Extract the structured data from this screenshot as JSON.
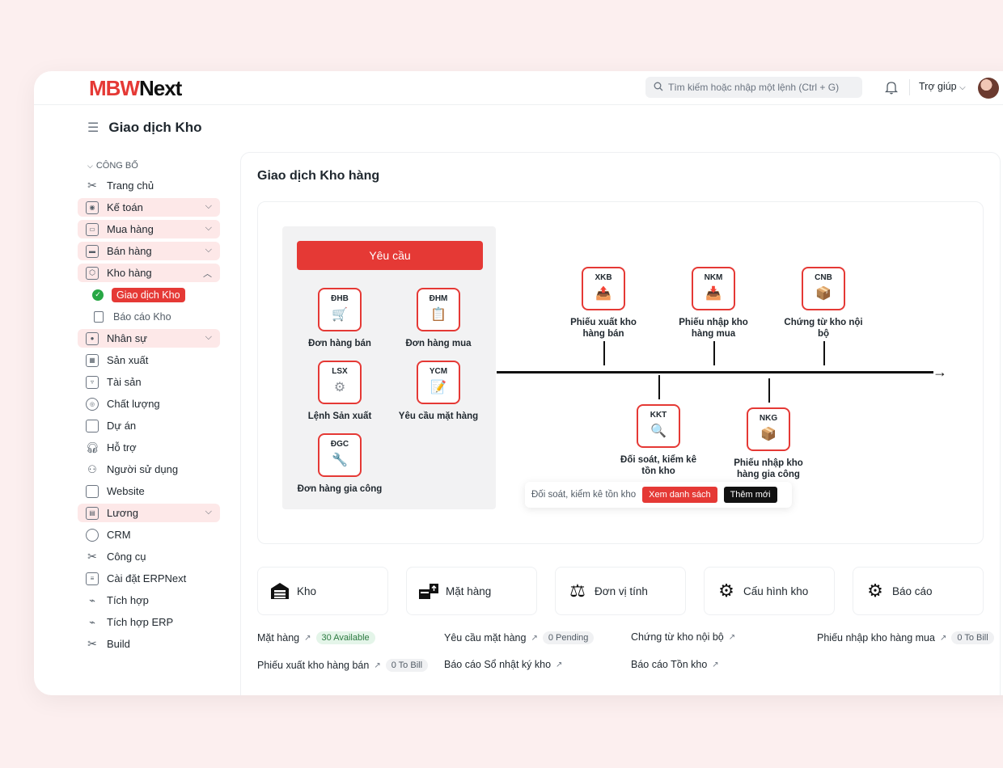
{
  "header": {
    "logo_brand": "MBW",
    "logo_next": "Next",
    "search_placeholder": "Tìm kiếm hoặc nhập một lệnh (Ctrl + G)",
    "help_label": "Trợ giúp"
  },
  "page": {
    "title": "Giao dịch Kho"
  },
  "sidebar": {
    "section": "CÔNG BỐ",
    "items": [
      {
        "label": "Trang chủ"
      },
      {
        "label": "Kế toán"
      },
      {
        "label": "Mua hàng"
      },
      {
        "label": "Bán hàng"
      },
      {
        "label": "Kho hàng"
      },
      {
        "label": "Nhân sự"
      },
      {
        "label": "Sản xuất"
      },
      {
        "label": "Tài sản"
      },
      {
        "label": "Chất lượng"
      },
      {
        "label": "Dự án"
      },
      {
        "label": "Hỗ trợ"
      },
      {
        "label": "Người sử dụng"
      },
      {
        "label": "Website"
      },
      {
        "label": "Lương"
      },
      {
        "label": "CRM"
      },
      {
        "label": "Công cụ"
      },
      {
        "label": "Cài đặt ERPNext"
      },
      {
        "label": "Tích hợp"
      },
      {
        "label": "Tích hợp ERP"
      },
      {
        "label": "Build"
      }
    ],
    "sub_active": "Giao dịch Kho",
    "sub_other": "Báo cáo Kho"
  },
  "main": {
    "title": "Giao dịch Kho hàng",
    "request_button": "Yêu cầu",
    "request_nodes": [
      {
        "code": "ĐHB",
        "label": "Đơn hàng bán"
      },
      {
        "code": "ĐHM",
        "label": "Đơn hàng mua"
      },
      {
        "code": "LSX",
        "label": "Lệnh Sản xuất"
      },
      {
        "code": "YCM",
        "label": "Yêu cầu mặt hàng"
      },
      {
        "code": "ĐGC",
        "label": "Đơn hàng gia công"
      }
    ],
    "flow_nodes": [
      {
        "code": "XKB",
        "label": "Phiếu xuất kho hàng bán"
      },
      {
        "code": "NKM",
        "label": "Phiếu nhập kho hàng mua"
      },
      {
        "code": "CNB",
        "label": "Chứng từ kho nội bộ"
      },
      {
        "code": "KKT",
        "label": "Đối soát, kiểm kê tồn kho"
      },
      {
        "code": "NKG",
        "label": "Phiếu nhập kho hàng gia công"
      }
    ],
    "tooltip": {
      "text": "Đối soát, kiểm kê tồn kho",
      "view_button": "Xem danh sách",
      "add_button": "Thêm mới"
    },
    "cards": [
      {
        "label": "Kho",
        "icon": "warehouse-icon"
      },
      {
        "label": "Mặt hàng",
        "icon": "items-icon"
      },
      {
        "label": "Đơn vị tính",
        "icon": "scale-icon"
      },
      {
        "label": "Cấu hình kho",
        "icon": "gear-icon"
      },
      {
        "label": "Báo cáo",
        "icon": "gear-icon"
      }
    ],
    "links": [
      {
        "label": "Mặt hàng",
        "badge": "30 Available"
      },
      {
        "label": "Yêu cầu mặt hàng",
        "badge": "0 Pending"
      },
      {
        "label": "Chứng từ kho nội bộ",
        "badge": ""
      },
      {
        "label": "Phiếu nhập kho hàng mua",
        "badge": "0 To Bill"
      },
      {
        "label": "Phiếu xuất kho hàng bán",
        "badge": "0 To Bill"
      },
      {
        "label": "Báo cáo Sổ nhật ký kho",
        "badge": ""
      },
      {
        "label": "Báo cáo Tồn kho",
        "badge": ""
      }
    ]
  },
  "colors": {
    "accent": "#e53935",
    "success": "#28a745",
    "background": "#fcefef"
  }
}
